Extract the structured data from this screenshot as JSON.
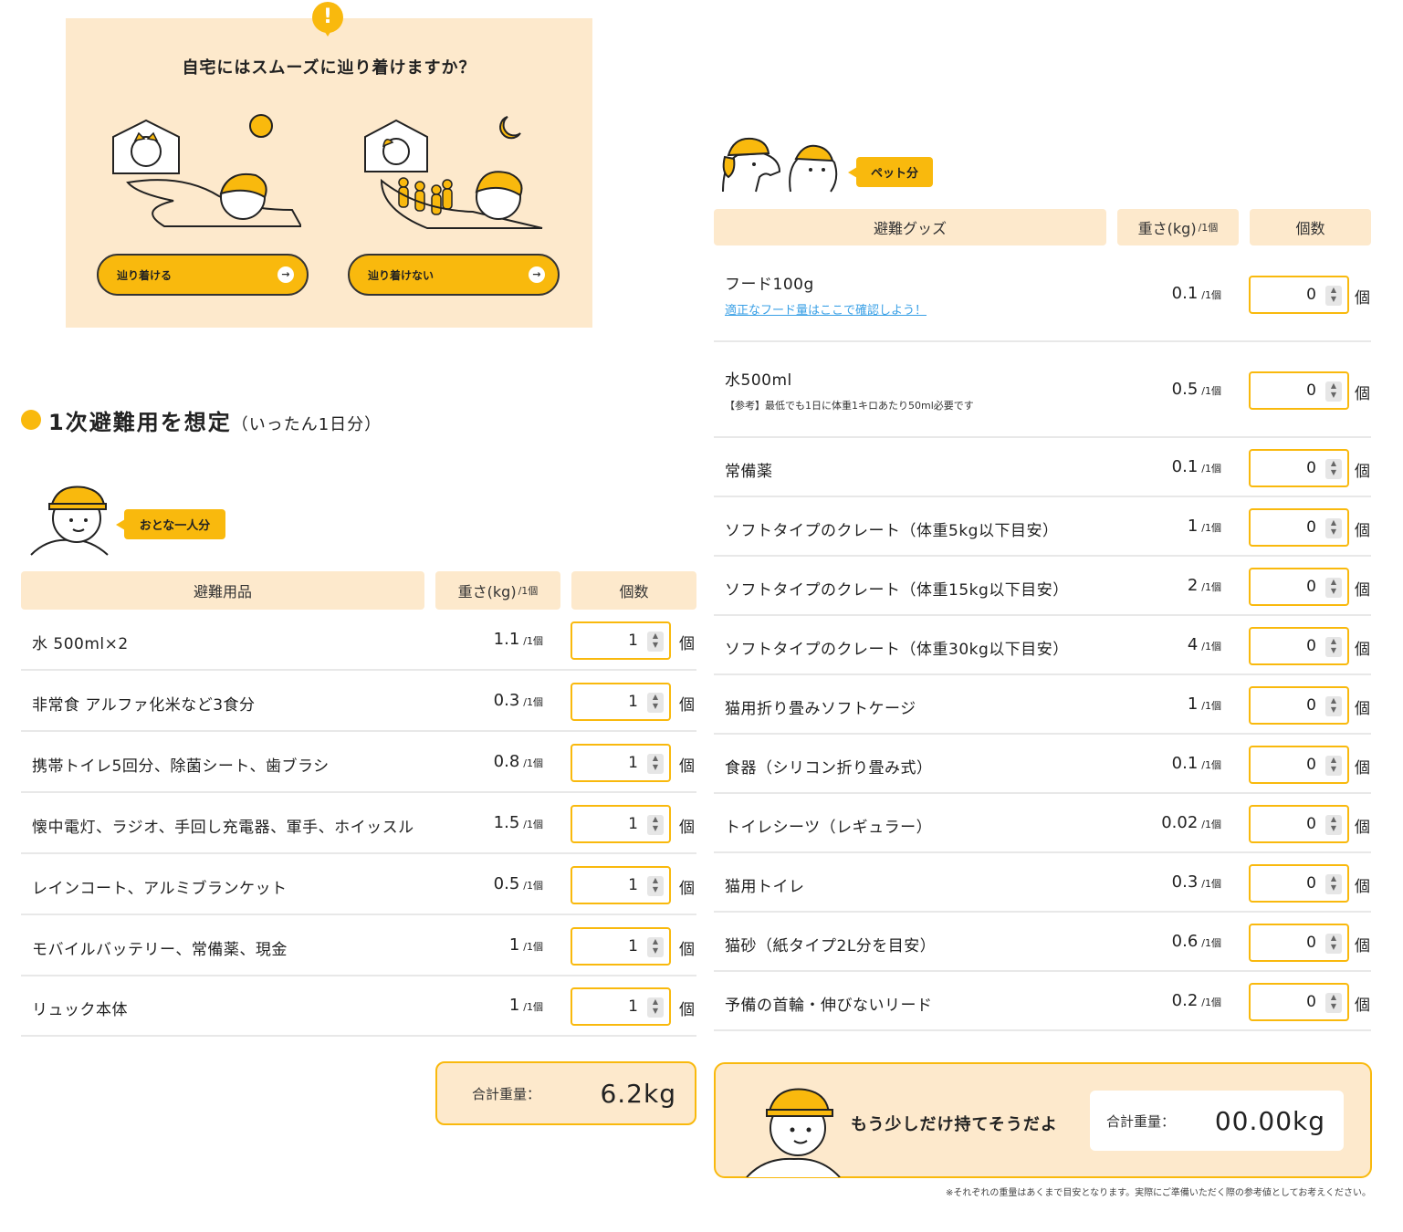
{
  "question": {
    "title": "自宅にはスムーズに辿り着けますか？",
    "btn_yes": "辿り着ける",
    "btn_no": "辿り着けない"
  },
  "section": {
    "title": "1次避難用を想定",
    "title_note": "（いったん1日分）"
  },
  "adult": {
    "badge": "おとな一人分",
    "headers": {
      "item": "避難用品",
      "weight": "重さ(kg)",
      "weight_unit": "/1個",
      "qty": "個数"
    },
    "rows": [
      {
        "name": "水 500ml×2",
        "weight": "1.1",
        "per": "/1個",
        "qty": "1",
        "unit": "個"
      },
      {
        "name": "非常食 アルファ化米など3食分",
        "weight": "0.3",
        "per": "/1個",
        "qty": "1",
        "unit": "個"
      },
      {
        "name": "携帯トイレ5回分、除菌シート、歯ブラシ",
        "weight": "0.8",
        "per": "/1個",
        "qty": "1",
        "unit": "個"
      },
      {
        "name": "懐中電灯、ラジオ、手回し充電器、軍手、ホイッスル",
        "weight": "1.5",
        "per": "/1個",
        "qty": "1",
        "unit": "個"
      },
      {
        "name": "レインコート、アルミブランケット",
        "weight": "0.5",
        "per": "/1個",
        "qty": "1",
        "unit": "個"
      },
      {
        "name": "モバイルバッテリー、常備薬、現金",
        "weight": "1",
        "per": "/1個",
        "qty": "1",
        "unit": "個"
      },
      {
        "name": "リュック本体",
        "weight": "1",
        "per": "/1個",
        "qty": "1",
        "unit": "個"
      }
    ],
    "total_label": "合計重量：",
    "total_value": "6.2kg"
  },
  "pet": {
    "badge": "ペット分",
    "headers": {
      "item": "避難グッズ",
      "weight": "重さ(kg)",
      "weight_unit": "/1個",
      "qty": "個数"
    },
    "rows": [
      {
        "name": "フード100g",
        "link": "適正なフード量はここで確認しよう！",
        "weight": "0.1",
        "per": "/1個",
        "qty": "0",
        "unit": "個"
      },
      {
        "name": "水500ml",
        "note": "【参考】最低でも1日に体重1キロあたり50ml必要です",
        "weight": "0.5",
        "per": "/1個",
        "qty": "0",
        "unit": "個"
      },
      {
        "name": "常備薬",
        "weight": "0.1",
        "per": "/1個",
        "qty": "0",
        "unit": "個"
      },
      {
        "name": "ソフトタイプのクレート（体重5kg以下目安）",
        "weight": "1",
        "per": "/1個",
        "qty": "0",
        "unit": "個"
      },
      {
        "name": "ソフトタイプのクレート（体重15kg以下目安）",
        "weight": "2",
        "per": "/1個",
        "qty": "0",
        "unit": "個"
      },
      {
        "name": "ソフトタイプのクレート（体重30kg以下目安）",
        "weight": "4",
        "per": "/1個",
        "qty": "0",
        "unit": "個"
      },
      {
        "name": "猫用折り畳みソフトケージ",
        "weight": "1",
        "per": "/1個",
        "qty": "0",
        "unit": "個"
      },
      {
        "name": "食器（シリコン折り畳み式）",
        "weight": "0.1",
        "per": "/1個",
        "qty": "0",
        "unit": "個"
      },
      {
        "name": "トイレシーツ（レギュラー）",
        "weight": "0.02",
        "per": "/1個",
        "qty": "0",
        "unit": "個"
      },
      {
        "name": "猫用トイレ",
        "weight": "0.3",
        "per": "/1個",
        "qty": "0",
        "unit": "個"
      },
      {
        "name": "猫砂（紙タイプ2L分を目安）",
        "weight": "0.6",
        "per": "/1個",
        "qty": "0",
        "unit": "個"
      },
      {
        "name": "予備の首輪・伸びないリード",
        "weight": "0.2",
        "per": "/1個",
        "qty": "0",
        "unit": "個"
      }
    ],
    "message": "もう少しだけ持てそうだよ",
    "total_label": "合計重量：",
    "total_value": "00.00kg"
  },
  "footnote": "※それぞれの重量はあくまで目安となります。実際にご準備いただく際の参考値としてお考えください。",
  "colors": {
    "accent": "#f9b90d",
    "cream": "#fde9cc",
    "link": "#3aa0e6"
  }
}
